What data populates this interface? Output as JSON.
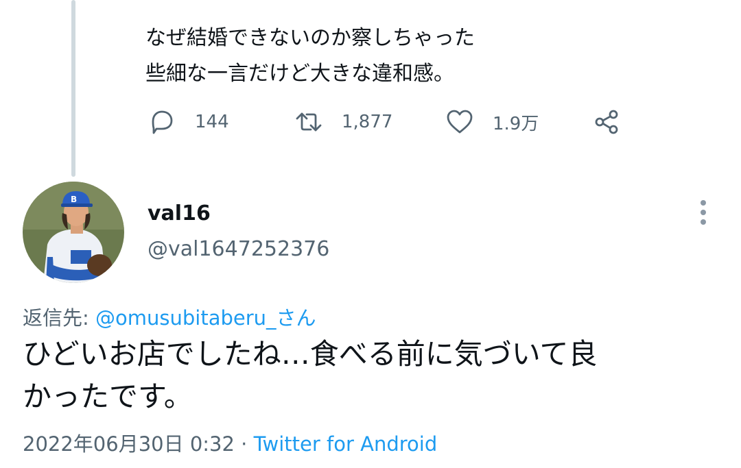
{
  "parent_tweet": {
    "text": "なぜ結婚できないのか察しちゃった\n些細な一言だけど大きな違和感。",
    "actions": {
      "reply_icon": "reply-bubble-icon",
      "reply_count": "144",
      "retweet_icon": "retweet-icon",
      "retweet_count": "1,877",
      "like_icon": "heart-icon",
      "like_count": "1.9万",
      "share_icon": "share-icon"
    }
  },
  "reply_tweet": {
    "author": {
      "display_name": "val16",
      "handle": "@val1647252376",
      "avatar": "baseball-player-avatar"
    },
    "more_icon": "vertical-dots-icon",
    "reply_to_label": "返信先: ",
    "reply_to_user": "@omusubitaberu_さん",
    "text": "ひどいお店でしたね…食べる前に気づいて良\nかったです。",
    "timestamp": "2022年06月30日 0:32",
    "separator": " · ",
    "source": "Twitter for Android"
  },
  "colors": {
    "primary_text": "#0f1419",
    "secondary_text": "#536471",
    "link": "#1d9bf0",
    "thread_line": "#cfd9de"
  }
}
